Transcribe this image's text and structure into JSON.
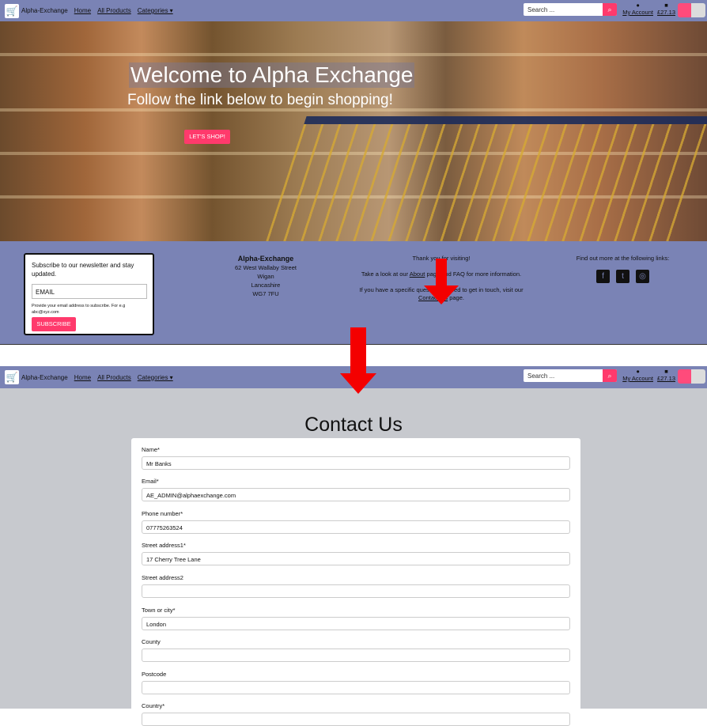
{
  "nav": {
    "brand": "Alpha-Exchange",
    "home": "Home",
    "all_products": "All Products",
    "categories": "Categories ▾",
    "search_placeholder": "Search ...",
    "account": "My Account",
    "bag_total": "£27.13"
  },
  "hero": {
    "title": "Welcome to Alpha Exchange",
    "subtitle": "Follow the link below to begin shopping!",
    "shop_button": "LET'S SHOP!"
  },
  "footer": {
    "newsletter_text": "Subscribe to our newsletter and stay updated.",
    "email_placeholder": "EMAIL",
    "email_hint": "Provide your email address to subscribe. For e.g abc@xyz.com",
    "subscribe": "SUBSCRIBE",
    "company": "Alpha-Exchange",
    "address": [
      "62 West Wallaby Street",
      "Wigan",
      "Lancashire",
      "WG7 7FU"
    ],
    "thanks": "Thank you for visiting!",
    "about_pre": "Take a look at our",
    "about_link": "About",
    "about_post": "page and FAQ for more information.",
    "contact_pre": "If you have a specific question or need to get in touch, visit our",
    "contact_link": "Contact Us",
    "contact_post": "page.",
    "social_text": "Find out more at the following links:"
  },
  "contact": {
    "title": "Contact Us",
    "fields": [
      {
        "label": "Name*",
        "value": "Mr Banks"
      },
      {
        "label": "Email*",
        "value": "AE_ADMIN@alphaexchange.com"
      },
      {
        "label": "Phone number*",
        "value": "07775263524"
      },
      {
        "label": "Street address1*",
        "value": "17 Cherry Tree Lane"
      },
      {
        "label": "Street address2",
        "value": ""
      },
      {
        "label": "Town or city*",
        "value": "London"
      },
      {
        "label": "County",
        "value": ""
      },
      {
        "label": "Postcode",
        "value": ""
      },
      {
        "label": "Country*",
        "value": ""
      }
    ]
  },
  "colors": {
    "nav": "#7a83b5",
    "accent": "#ff3a6c",
    "arrow": "#f40000",
    "form_bg": "#c7c9ce"
  },
  "icons": [
    "search-icon",
    "user-icon",
    "shopping-bag-icon",
    "facebook-icon",
    "twitter-icon",
    "instagram-icon"
  ]
}
